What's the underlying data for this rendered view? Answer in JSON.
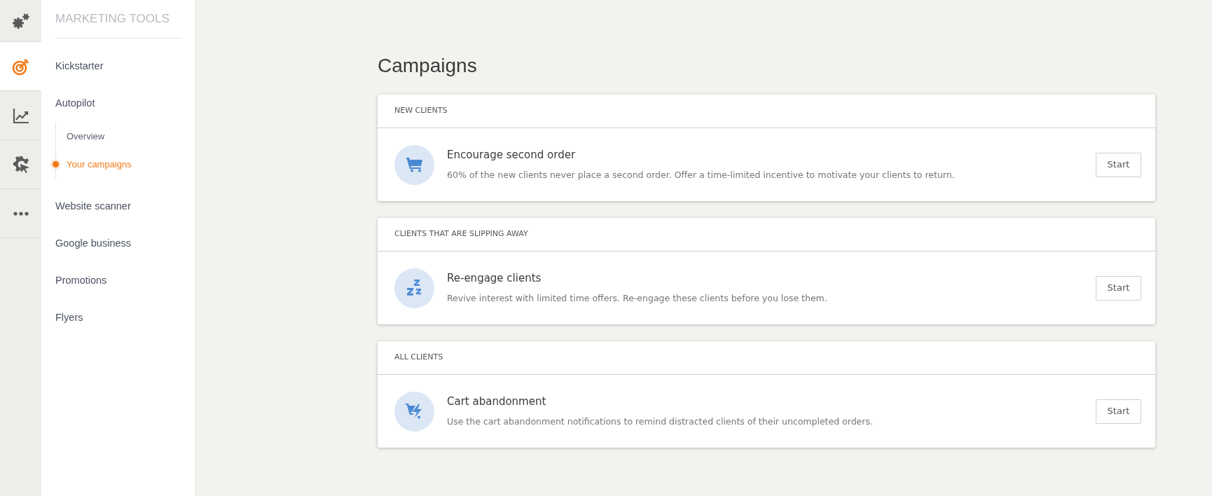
{
  "rail": [
    {
      "kind": "gears",
      "selected": false
    },
    {
      "kind": "target",
      "selected": true
    },
    {
      "kind": "chart",
      "selected": false
    },
    {
      "kind": "gear-cursor",
      "selected": false
    },
    {
      "kind": "dots",
      "selected": false
    }
  ],
  "sidebar": {
    "title": "MARKETING TOOLS",
    "items": [
      {
        "label": "Kickstarter",
        "selected": false
      },
      {
        "label": "Autopilot",
        "selected": false,
        "children": [
          {
            "label": "Overview",
            "selected": false
          },
          {
            "label": "Your campaigns",
            "selected": true
          }
        ]
      },
      {
        "label": "Website scanner",
        "selected": false
      },
      {
        "label": "Google business",
        "selected": false
      },
      {
        "label": "Promotions",
        "selected": false
      },
      {
        "label": "Flyers",
        "selected": false
      }
    ]
  },
  "page_title": "Campaigns",
  "sections": [
    {
      "heading": "NEW CLIENTS",
      "campaign": {
        "kind": "cart",
        "title": "Encourage second order",
        "description": "60% of the new clients never place a second order. Offer a time-limited incentive to motivate your clients to return.",
        "button": "Start"
      }
    },
    {
      "heading": "CLIENTS THAT ARE SLIPPING AWAY",
      "campaign": {
        "kind": "sleep",
        "title": "Re-engage clients",
        "description": "Revive interest with limited time offers. Re-engage these clients before you lose them.",
        "button": "Start"
      }
    },
    {
      "heading": "ALL CLIENTS",
      "campaign": {
        "kind": "cart-lightning",
        "title": "Cart abandonment",
        "description": "Use the cart abandonment notifications to remind distracted clients of their uncompleted orders.",
        "button": "Start"
      }
    }
  ]
}
